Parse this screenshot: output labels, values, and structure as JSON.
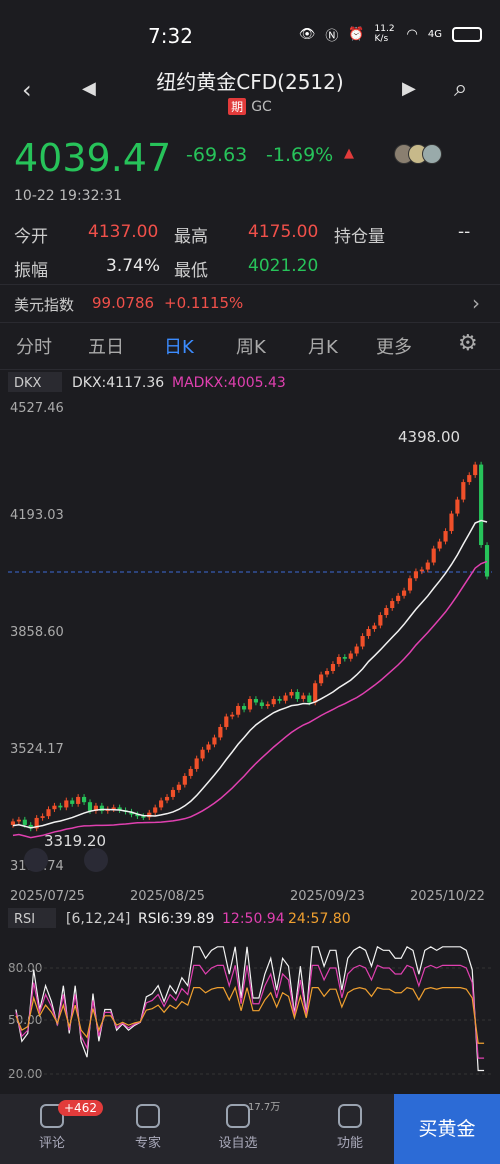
{
  "status": {
    "time": "7:32",
    "net": "11.2 K/s",
    "signal": "4G"
  },
  "nav": {
    "title": "纽约黄金CFD(2512)",
    "tag": "期",
    "code": "GC"
  },
  "quote": {
    "price": "4039.47",
    "change": "-69.63",
    "pct": "-1.69%",
    "timestamp": "10-22 19:32:31",
    "open_label": "今开",
    "open": "4137.00",
    "high_label": "最高",
    "high": "4175.00",
    "oi_label": "持仓量",
    "oi": "--",
    "amp_label": "振幅",
    "amp": "3.74%",
    "low_label": "最低",
    "low": "4021.20"
  },
  "usd": {
    "label": "美元指数",
    "value": "99.0786",
    "change": "+0.1115%"
  },
  "tabs": [
    "分时",
    "五日",
    "日K",
    "周K",
    "月K",
    "更多"
  ],
  "kchart": {
    "indicator": "DKX",
    "dkx_label": "DKX:4117.36",
    "madkx_label": "MADKX:4005.43",
    "y_labels": [
      "4527.46",
      "4193.03",
      "3858.60",
      "3524.17",
      "3189.74"
    ],
    "x_labels": [
      "2025/07/25",
      "2025/08/25",
      "2025/09/23",
      "2025/10/22"
    ],
    "max_label": "4398.00",
    "min_label": "3319.20"
  },
  "rsi": {
    "name": "RSI",
    "params": "[6,12,24]",
    "rsi6": "RSI6:39.89",
    "rsi12": "12:50.94",
    "rsi24": "24:57.80",
    "y_labels": [
      "80.00",
      "50.00",
      "20.00"
    ]
  },
  "bottom": {
    "items": [
      "评论",
      "专家",
      "设自选",
      "功能"
    ],
    "badge": "+462",
    "sup": "17.7万",
    "buy": "买黄金"
  },
  "chart_data": {
    "type": "candlestick",
    "ylim": [
      3189.74,
      4527.46
    ],
    "closes": [
      3340,
      3345,
      3330,
      3320,
      3350,
      3355,
      3375,
      3385,
      3380,
      3400,
      3390,
      3410,
      3395,
      3370,
      3385,
      3370,
      3375,
      3380,
      3372,
      3368,
      3360,
      3355,
      3352,
      3365,
      3380,
      3400,
      3410,
      3430,
      3445,
      3470,
      3490,
      3520,
      3545,
      3560,
      3580,
      3610,
      3640,
      3645,
      3670,
      3660,
      3690,
      3680,
      3670,
      3675,
      3690,
      3685,
      3700,
      3710,
      3690,
      3700,
      3680,
      3735,
      3760,
      3770,
      3790,
      3810,
      3805,
      3820,
      3840,
      3870,
      3890,
      3900,
      3930,
      3950,
      3970,
      3985,
      4000,
      4035,
      4055,
      4060,
      4080,
      4120,
      4140,
      4170,
      4220,
      4260,
      4310,
      4330,
      4360,
      4130,
      4040
    ],
    "dkx_last": 4117.36,
    "madkx_last": 4005.43
  }
}
